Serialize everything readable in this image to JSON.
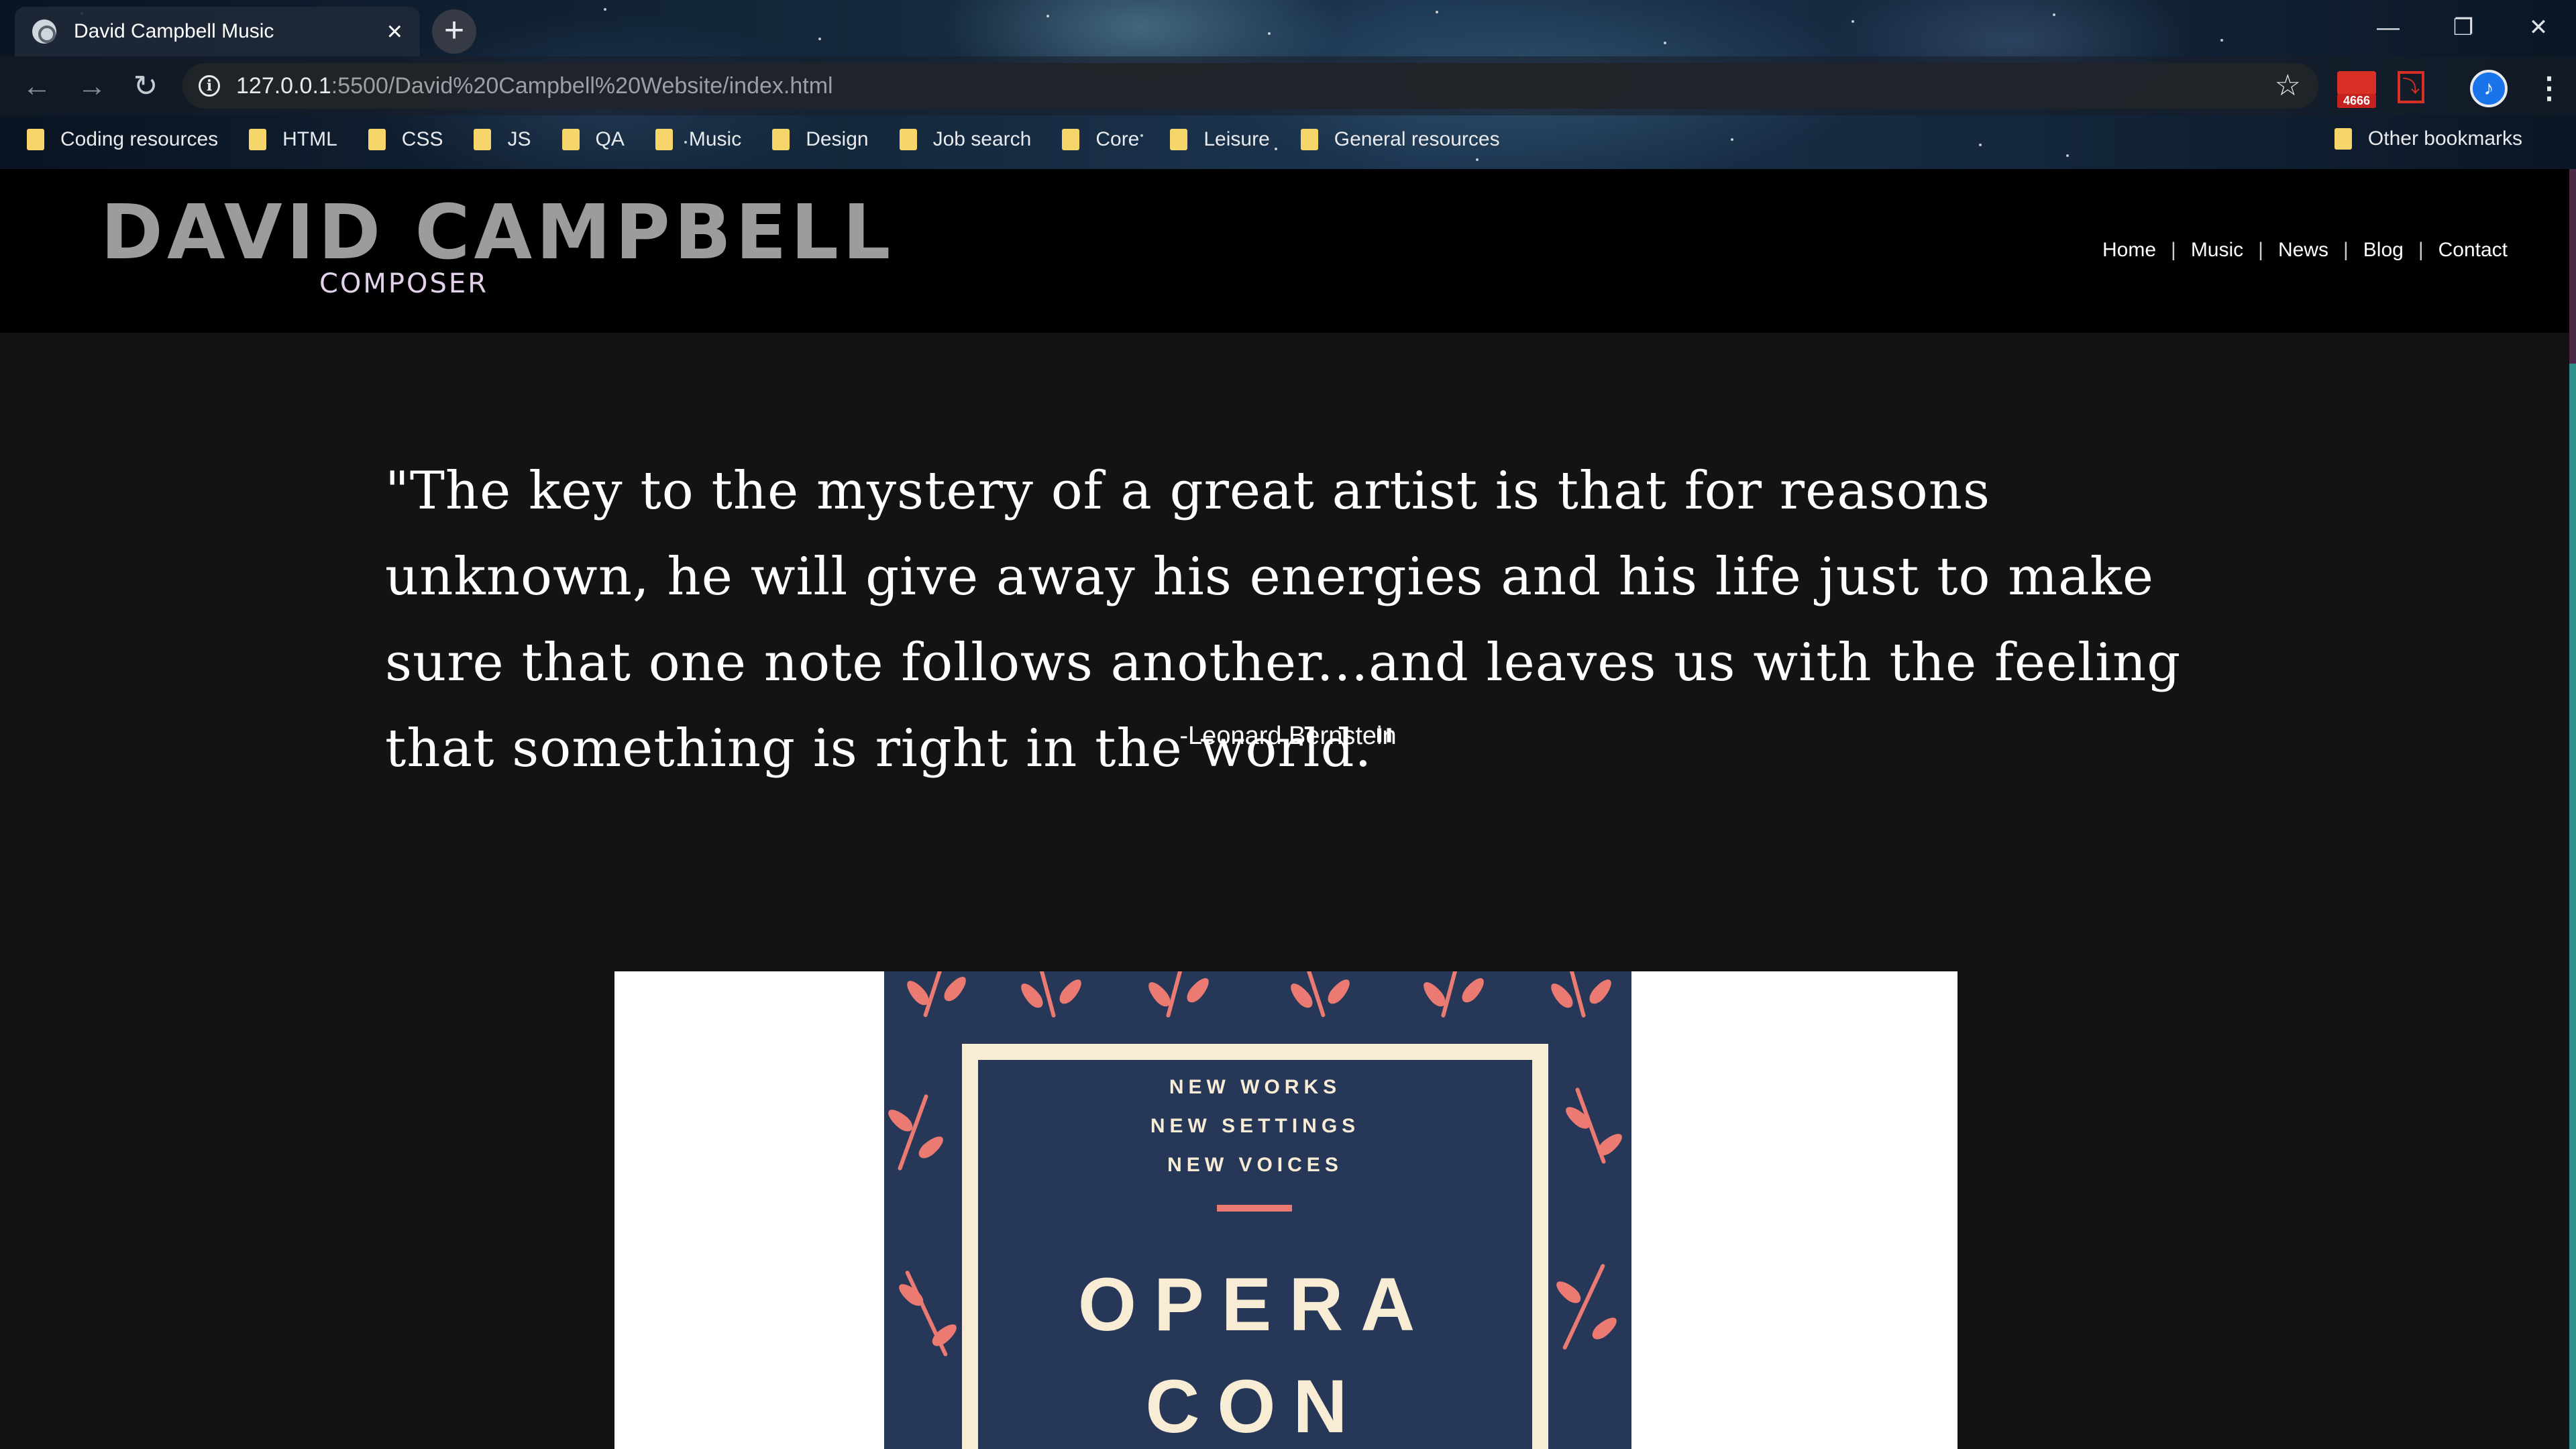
{
  "browser": {
    "tab_title": "David Campbell Music",
    "new_tab": "+",
    "url_host": "127.0.0.1",
    "url_rest": ":5500/David%20Campbell%20Website/index.html",
    "extension_badge": "4666",
    "avatar_glyph": "♪",
    "window_controls": [
      "—",
      "❐",
      "✕"
    ],
    "bookmarks": [
      "Coding resources",
      "HTML",
      "CSS",
      "JS",
      "QA",
      "Music",
      "Design",
      "Job search",
      "Core",
      "Leisure",
      "General resources"
    ],
    "other_bookmarks": "Other bookmarks"
  },
  "site": {
    "logo_name": "DAVID CAMPBELL",
    "logo_sub": "COMPOSER",
    "nav": [
      "Home",
      "Music",
      "News",
      "Blog",
      "Contact"
    ],
    "quote": "\"The key to the mystery of a great artist is that for reasons unknown, he will give away his energies and his life just to make sure that one note follows another...and leaves us with the feeling that something is right in the world.\"",
    "attribution": "-Leonard Bernstein"
  },
  "poster": {
    "lines": [
      "NEW WORKS",
      "NEW SETTINGS",
      "NEW VOICES"
    ],
    "title_1": "OPERA",
    "title_2": "CON"
  },
  "colors": {
    "page_bg": "#131313",
    "header_bg": "#000000",
    "logo_gray": "#9c9c9c",
    "logo_sub": "#e3d0ea",
    "poster_navy": "#263757",
    "poster_cream": "#f8ecd4",
    "poster_coral": "#ea7a72"
  }
}
